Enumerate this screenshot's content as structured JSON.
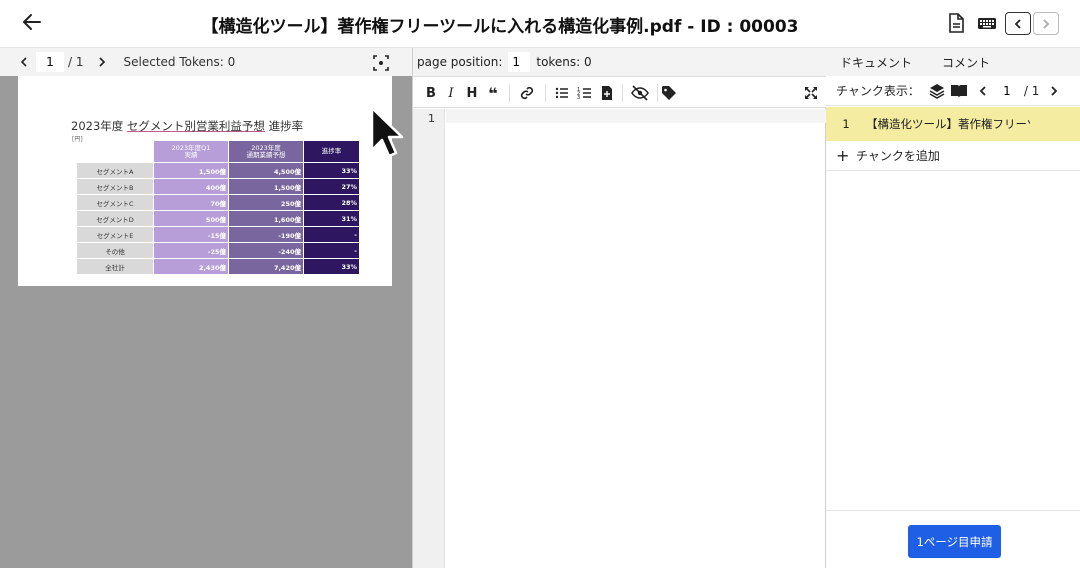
{
  "header": {
    "title": "【構造化ツール】著作権フリーツールに入れる構造化事例.pdf - ID : 00003"
  },
  "left": {
    "page_current": "1",
    "page_total": "/ 1",
    "selected_tokens": "Selected Tokens: 0"
  },
  "pdf": {
    "title_plain": "2023年度 ",
    "title_underlined": "セグメント別営業利益予想",
    "title_tail": " 進捗率",
    "unit": "[円]",
    "headers": [
      "2023年度Q1\n実績",
      "2023年度\n通期業績予想",
      "進捗率"
    ],
    "rows": [
      {
        "label": "セグメントA",
        "q1": "1,500億",
        "forecast": "4,500億",
        "rate": "33%"
      },
      {
        "label": "セグメントB",
        "q1": "400億",
        "forecast": "1,500億",
        "rate": "27%"
      },
      {
        "label": "セグメントC",
        "q1": "70億",
        "forecast": "250億",
        "rate": "28%"
      },
      {
        "label": "セグメントD",
        "q1": "500億",
        "forecast": "1,600億",
        "rate": "31%"
      },
      {
        "label": "セグメントE",
        "q1": "-15億",
        "forecast": "-190億",
        "rate": "-"
      },
      {
        "label": "その他",
        "q1": "-25億",
        "forecast": "-240億",
        "rate": "-"
      },
      {
        "label": "全社計",
        "q1": "2,430億",
        "forecast": "7,420億",
        "rate": "33%"
      }
    ]
  },
  "middle": {
    "page_position_label": "page position:",
    "page_position_value": "1",
    "tokens": "tokens: 0",
    "line_number": "1"
  },
  "right": {
    "tab_document": "ドキュメント",
    "tab_comment": "コメント",
    "chunk_display_label": "チャンク表示：",
    "chunk_current": "1",
    "chunk_total": "/ 1",
    "chunk_row_number": "1",
    "chunk_row_text": "【構造化ツール】著作権フリーツ",
    "add_chunk": "チャンクを追加",
    "submit": "1ページ目申請"
  }
}
